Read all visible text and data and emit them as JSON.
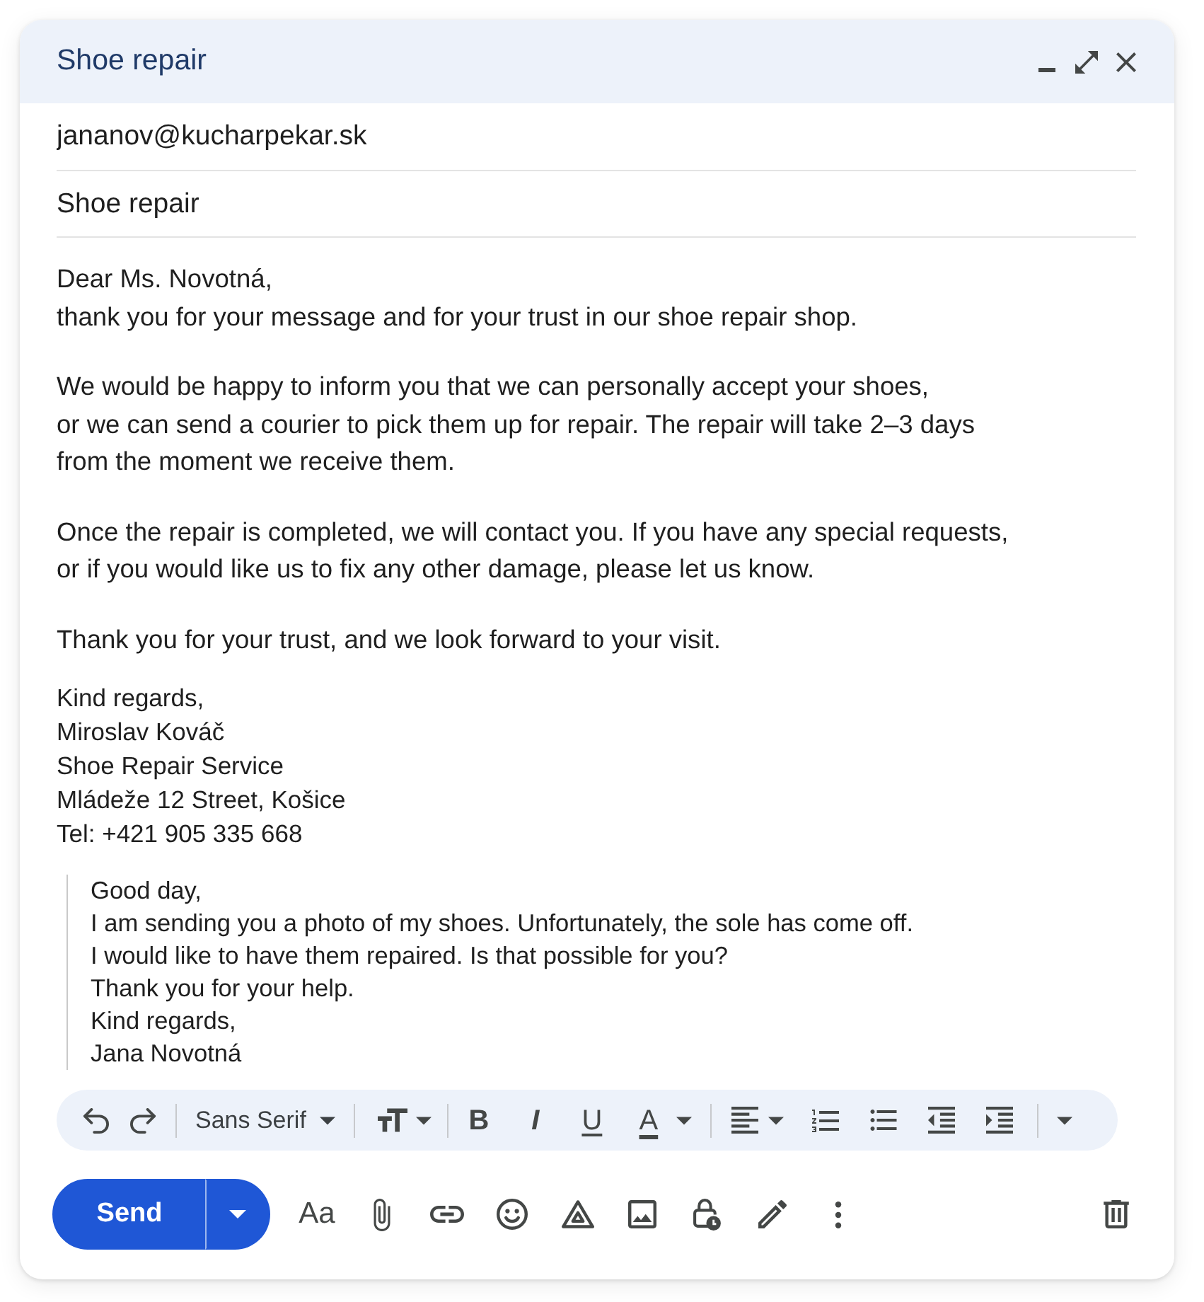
{
  "window": {
    "title": "Shoe repair"
  },
  "recipient": {
    "value": "jananov@kucharpekar.sk"
  },
  "subject": {
    "value": "Shoe repair"
  },
  "body": {
    "paragraphs": [
      [
        "Dear Ms. Novotná,",
        "thank you for your message and for your trust in our shoe repair shop."
      ],
      [
        "We would be happy to inform you that we can personally accept your shoes,",
        "or we can send a courier to pick them up for repair. The repair will take 2–3 days",
        "from the moment we receive them."
      ],
      [
        "Once the repair is completed, we will contact you. If you have any special requests,",
        "or if you would like us to fix any other damage, please let us know."
      ],
      [
        "Thank you for your trust, and we look forward to your visit."
      ]
    ],
    "signature": [
      "Kind regards,",
      "Miroslav Kováč",
      "Shoe Repair Service",
      "Mládeže 12 Street, Košice",
      "Tel: +421 905 335 668"
    ],
    "quoted": [
      "Good day,",
      "I am sending you a photo of my shoes. Unfortunately, the sole has come off.",
      "I would like to have them repaired. Is that possible for you?",
      "Thank you for your help.",
      "Kind regards,",
      "Jana Novotná"
    ]
  },
  "toolbar": {
    "font": "Sans Serif",
    "format_buttons": [
      {
        "kind": "bold",
        "label": "B"
      },
      {
        "kind": "italic",
        "label": "I"
      },
      {
        "kind": "underline",
        "label": "U"
      },
      {
        "kind": "text_color",
        "label": "A"
      }
    ]
  },
  "send_button": {
    "label": "Send"
  },
  "formatting_options_button": {
    "label": "Aa"
  }
}
